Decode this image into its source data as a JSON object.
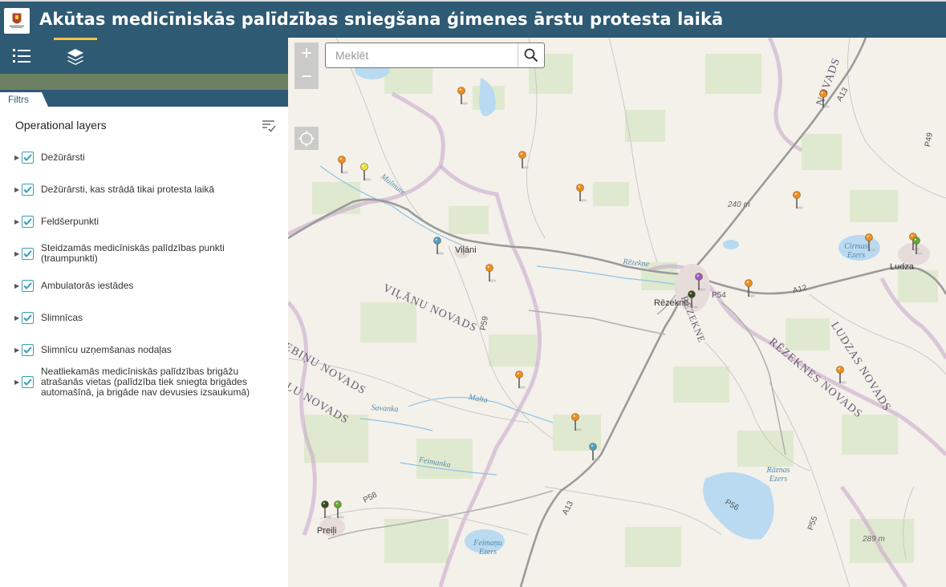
{
  "header": {
    "title": "Akūtas medicīniskās palīdzības sniegšana ģimenes ārstu protesta laikā"
  },
  "toolbar": {
    "tools": [
      {
        "icon": "list-icon"
      },
      {
        "icon": "layers-icon",
        "active": true
      }
    ]
  },
  "panel": {
    "tab_label": "Filtrs",
    "section_title": "Operational layers",
    "layers": [
      {
        "label": "Dežūrārsti",
        "checked": true
      },
      {
        "label": "Dežūrārsti, kas strādā tikai protesta laikā",
        "checked": true
      },
      {
        "label": "Feldšerpunkti",
        "checked": true
      },
      {
        "label": "Steidzamās medicīniskās palīdzības punkti (traumpunkti)",
        "checked": true
      },
      {
        "label": "Ambulatorās iestādes",
        "checked": true
      },
      {
        "label": "Slimnīcas",
        "checked": true
      },
      {
        "label": "Slimnīcu uzņemšanas nodaļas",
        "checked": true
      },
      {
        "label": "Neatliekamās medicīniskās palīdzības brigāžu atrašanās vietas (palīdzība tiek sniegta brigādes automašīnā, ja brigāde nav devusies izsaukumā)",
        "checked": true
      }
    ]
  },
  "map": {
    "search": {
      "placeholder": "Meklēt",
      "value": ""
    },
    "zoom_in": "+",
    "zoom_out": "−",
    "places": {
      "vilani": "Viļāni",
      "rezekne": "Rēzekne",
      "ludza": "Ludza",
      "preili": "Preiļi"
    },
    "regions": {
      "vilanu": "VIĻĀNU NOVADS",
      "rezeknes": "RĒZEKNES NOVADS",
      "ludzas": "LUDZAS NOVADS",
      "novads_top": "NOVADS",
      "novads_left1": "EBIŅU NOVADS",
      "novads_left2": "ĻU NOVADS",
      "rezekne_city": "RĒZEKNE"
    },
    "water": {
      "malmute": "Malmute",
      "rezekne_river": "Rēzekne",
      "malta": "Malta",
      "savanka": "Savanka",
      "feimanka": "Feimanka",
      "cirmas": "Cirmas Ezers",
      "raznas": "Rāznas Ezers",
      "feimanu": "Feimaņu Ezers"
    },
    "roads": {
      "a13_top": "A13",
      "a13_bottom": "A13",
      "a12": "A12",
      "p49": "P49",
      "p54": "P54",
      "p55": "P55",
      "p56": "P56",
      "p58": "P58",
      "p59": "P59"
    },
    "elevations": {
      "e240": "240 m",
      "e289": "289 m"
    },
    "pin_colors": {
      "orange": "#f28c1c",
      "yellow": "#e8e04a",
      "green": "#5fa83a",
      "blue": "#4a9fd0",
      "purple": "#9b59c9",
      "darkgreen": "#2e4a2a"
    }
  }
}
